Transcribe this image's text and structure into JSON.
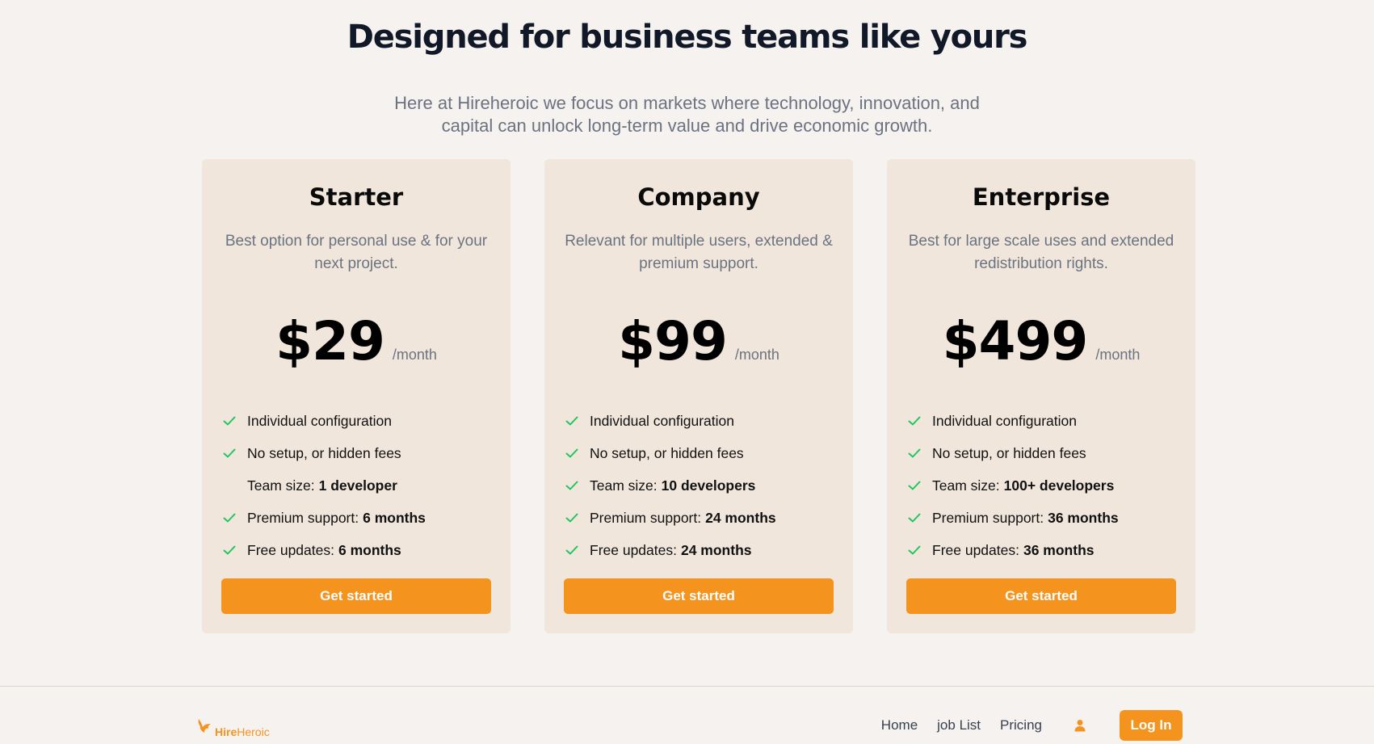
{
  "hero": {
    "title": "Designed for business teams like yours",
    "subtitle": "Here at Hireheroic we focus on markets where technology, innovation, and capital can unlock long-term value and drive economic growth."
  },
  "plans": [
    {
      "name": "Starter",
      "description": "Best option for personal use & for your next project.",
      "price": "$29",
      "period": "/month",
      "features": [
        {
          "label": "Individual configuration",
          "value": "",
          "check": true
        },
        {
          "label": "No setup, or hidden fees",
          "value": "",
          "check": true
        },
        {
          "label": "Team size:",
          "value": "1 developer",
          "check": false
        },
        {
          "label": "Premium support:",
          "value": "6 months",
          "check": true
        },
        {
          "label": "Free updates:",
          "value": "6 months",
          "check": true
        }
      ],
      "cta": "Get started"
    },
    {
      "name": "Company",
      "description": "Relevant for multiple users, extended & premium support.",
      "price": "$99",
      "period": "/month",
      "features": [
        {
          "label": "Individual configuration",
          "value": "",
          "check": true
        },
        {
          "label": "No setup, or hidden fees",
          "value": "",
          "check": true
        },
        {
          "label": "Team size:",
          "value": "10 developers",
          "check": true
        },
        {
          "label": "Premium support:",
          "value": "24 months",
          "check": true
        },
        {
          "label": "Free updates:",
          "value": "24 months",
          "check": true
        }
      ],
      "cta": "Get started"
    },
    {
      "name": "Enterprise",
      "description": "Best for large scale uses and extended redistribution rights.",
      "price": "$499",
      "period": "/month",
      "features": [
        {
          "label": "Individual configuration",
          "value": "",
          "check": true
        },
        {
          "label": "No setup, or hidden fees",
          "value": "",
          "check": true
        },
        {
          "label": "Team size:",
          "value": "100+ developers",
          "check": true
        },
        {
          "label": "Premium support:",
          "value": "36 months",
          "check": true
        },
        {
          "label": "Free updates:",
          "value": "36 months",
          "check": true
        }
      ],
      "cta": "Get started"
    }
  ],
  "footer": {
    "logo": {
      "part1": "Hire",
      "part2": "Heroic",
      "icon": "bird-logo-icon"
    },
    "nav": [
      "Home",
      "job List",
      "Pricing"
    ],
    "user_icon": "user-icon",
    "login": "Log In"
  },
  "colors": {
    "accent": "#f5931f",
    "check": "#22c55e",
    "card_bg": "#f0e6dc",
    "page_bg": "#f5f2ef"
  }
}
